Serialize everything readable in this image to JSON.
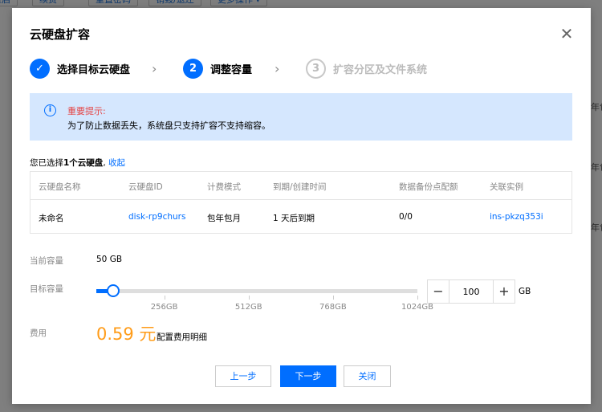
{
  "background": {
    "toolbar_buttons": [
      "重启",
      "续费",
      "重置密码",
      "销毁/退还",
      "更多操作 ▾"
    ],
    "side_texts": [
      "年包",
      "年包",
      "年包"
    ]
  },
  "dialog": {
    "title": "云硬盘扩容",
    "close_icon": "close-icon",
    "steps": [
      {
        "index": "✓",
        "label": "选择目标云硬盘",
        "state": "done"
      },
      {
        "index": "2",
        "label": "调整容量",
        "state": "active"
      },
      {
        "index": "3",
        "label": "扩容分区及文件系统",
        "state": "pending"
      }
    ],
    "step_separator": "›",
    "notice": {
      "icon": "info-icon",
      "icon_glyph": "i",
      "title": "重要提示:",
      "body": "为了防止数据丢失，系统盘只支持扩容不支持缩容。"
    },
    "selection": {
      "prefix": "您已选择",
      "count": "1个云硬盘",
      "suffix": ", ",
      "collapse": "收起"
    },
    "table": {
      "columns": [
        "云硬盘名称",
        "云硬盘ID",
        "计费模式",
        "到期/创建时间",
        "数据备份点配额",
        "关联实例"
      ],
      "rows": [
        [
          "未命名",
          "disk-rp9churs",
          "包年包月",
          "1 天后到期",
          "0/0",
          "ins-pkzq353i"
        ]
      ]
    },
    "current_capacity": {
      "label": "当前容量",
      "value": "50 GB"
    },
    "target_capacity": {
      "label": "目标容量",
      "value": "100",
      "unit": "GB",
      "minus": "−",
      "plus": "+",
      "slider_min": 50,
      "slider_max": 1024,
      "slider_value": 100,
      "ticks": [
        {
          "value": 256,
          "label": "256GB"
        },
        {
          "value": 512,
          "label": "512GB"
        },
        {
          "value": 768,
          "label": "768GB"
        },
        {
          "value": 1024,
          "label": "1024GB"
        }
      ]
    },
    "fee": {
      "label": "费用",
      "value": "0.59 元",
      "detail": "配置费用明细"
    },
    "buttons": {
      "prev": "上一步",
      "next": "下一步",
      "close": "关闭"
    },
    "colors": {
      "primary": "#006eff",
      "fee": "#ff9c19",
      "warning": "#e54545",
      "notice_bg": "#d5e7fe"
    }
  }
}
